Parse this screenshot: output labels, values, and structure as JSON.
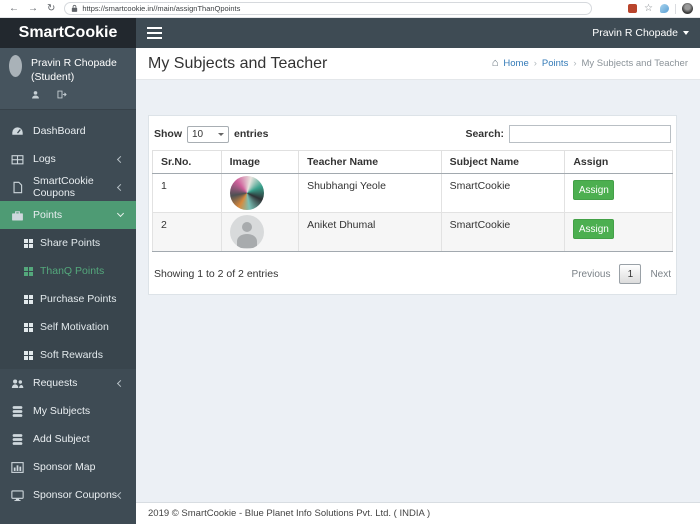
{
  "browser": {
    "url": "https://smartcookie.in//main/assignThanQpoints",
    "icons": {
      "back": "←",
      "forward": "→",
      "reload": "↻",
      "star": "☆",
      "home": "⌂"
    }
  },
  "sidebar": {
    "logo": "SmartCookie",
    "user": {
      "name": "Pravin R Chopade",
      "role": "(Student)"
    },
    "items": [
      {
        "label": "DashBoard"
      },
      {
        "label": "Logs"
      },
      {
        "label": "SmartCookie Coupons"
      },
      {
        "label": "Points"
      },
      {
        "label": "Requests"
      },
      {
        "label": "My Subjects"
      },
      {
        "label": "Add Subject"
      },
      {
        "label": "Sponsor Map"
      },
      {
        "label": "Sponsor Coupons"
      }
    ],
    "points_submenu": [
      {
        "label": "Share Points"
      },
      {
        "label": "ThanQ Points"
      },
      {
        "label": "Purchase Points"
      },
      {
        "label": "Self Motivation"
      },
      {
        "label": "Soft Rewards"
      }
    ]
  },
  "topbar": {
    "user_menu": "Pravin R Chopade"
  },
  "page": {
    "title": "My Subjects and Teacher",
    "breadcrumb_sep": "›",
    "breadcrumb": [
      {
        "label": "Home"
      },
      {
        "label": "Points"
      },
      {
        "label": "My Subjects and Teacher"
      }
    ]
  },
  "table": {
    "show_label": "Show",
    "page_size": "10",
    "entries_label": "entries",
    "search_label": "Search:",
    "columns": [
      "Sr.No.",
      "Image",
      "Teacher Name",
      "Subject Name",
      "Assign"
    ],
    "rows": [
      {
        "sr": "1",
        "teacher": "Shubhangi Yeole",
        "subject": "SmartCookie",
        "action": "Assign"
      },
      {
        "sr": "2",
        "teacher": "Aniket Dhumal",
        "subject": "SmartCookie",
        "action": "Assign"
      }
    ],
    "info": "Showing 1 to 2 of 2 entries",
    "pagination": {
      "previous": "Previous",
      "page": "1",
      "next": "Next"
    }
  },
  "footer": {
    "text": "2019 © SmartCookie - Blue Planet Info Solutions Pvt. Ltd. ( INDIA )"
  },
  "colors": {
    "sidebar_bg": "#3e4b54",
    "logo_bg": "#22282e",
    "submenu_bg": "#39454d",
    "active_green": "#4e9b74",
    "active_link_green": "#54a87c",
    "assign_green": "#4caf50",
    "link_blue": "#337ab7",
    "content_bg": "#ecf0f5"
  }
}
